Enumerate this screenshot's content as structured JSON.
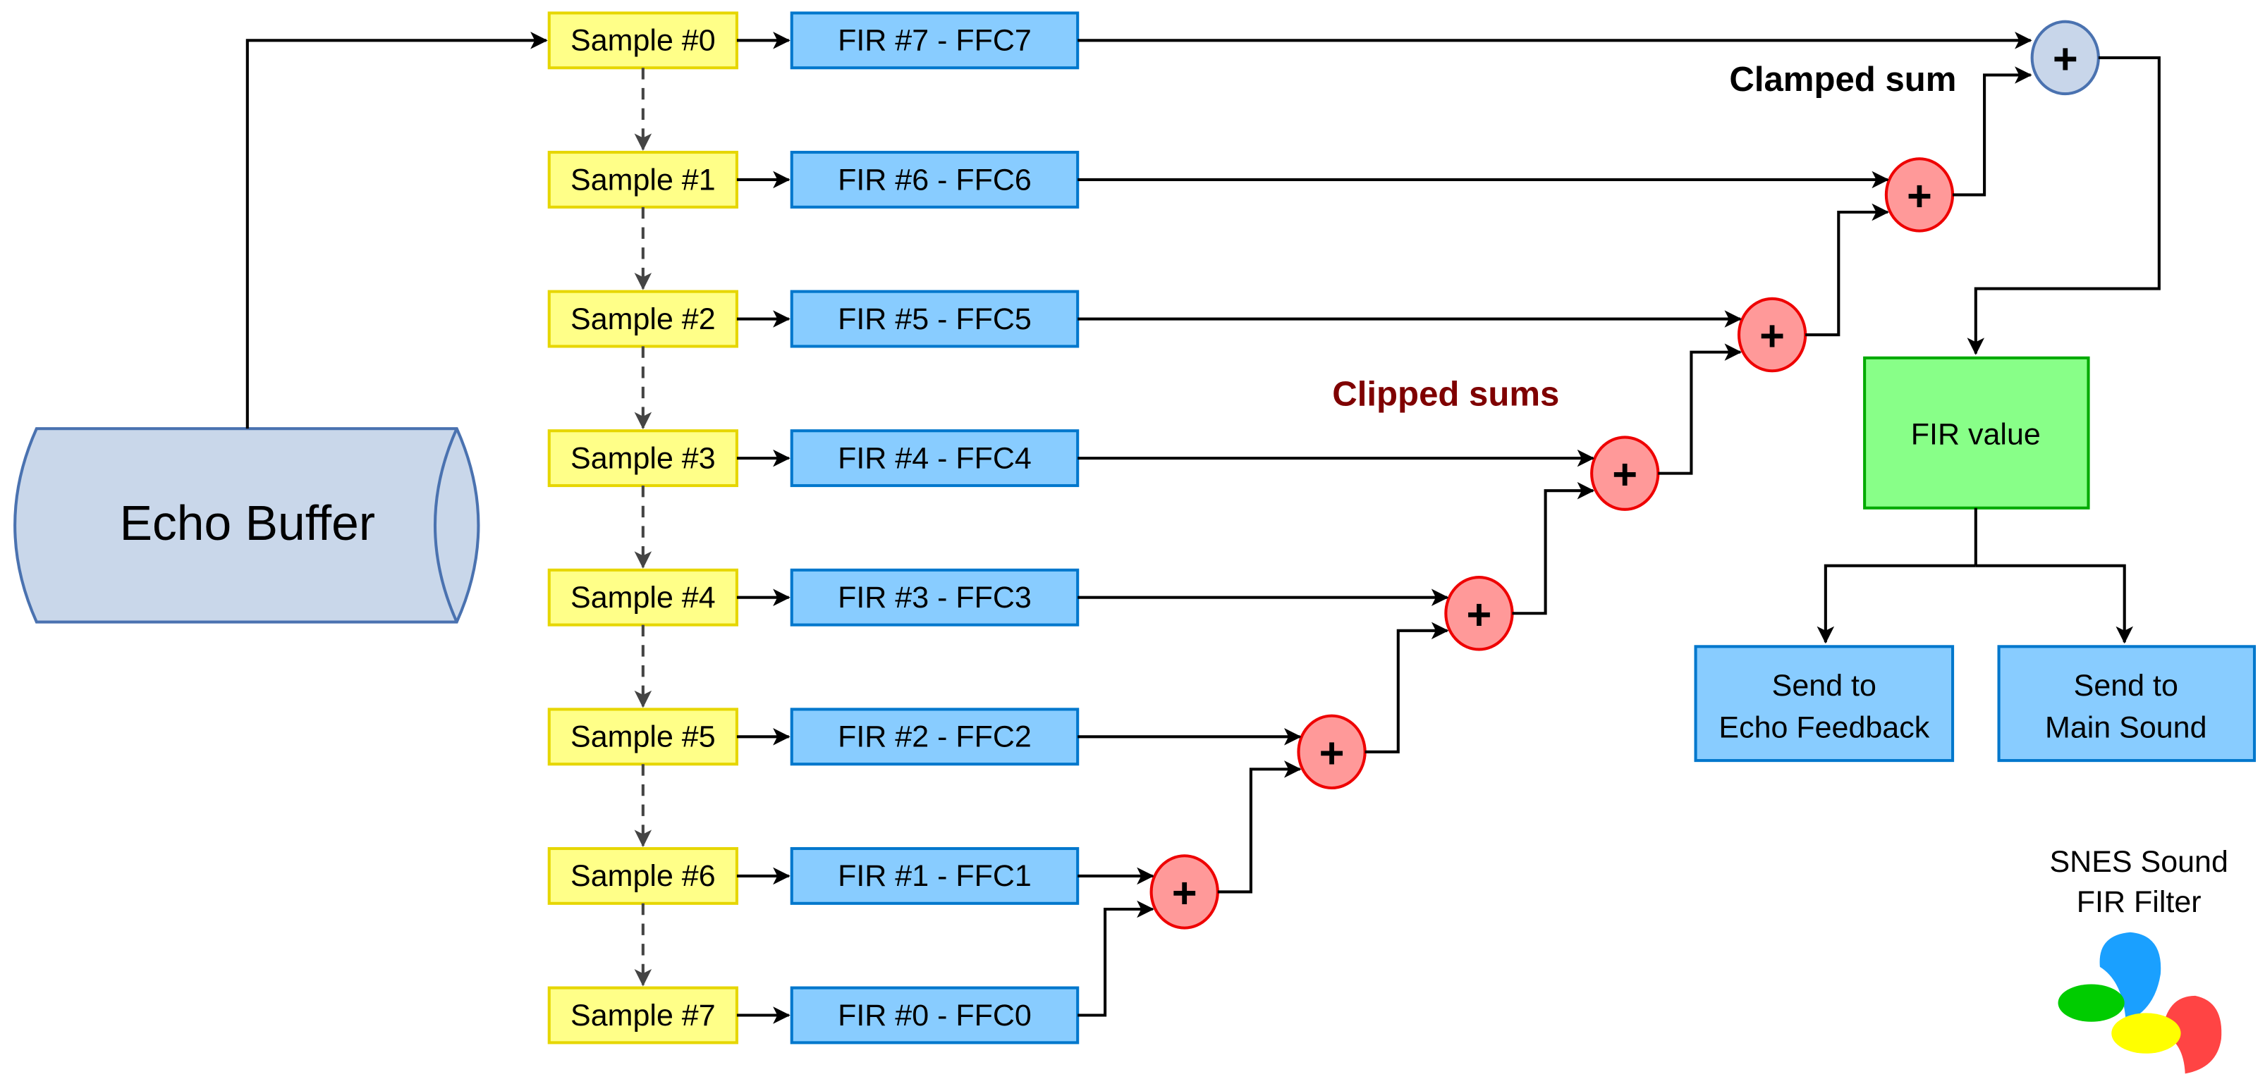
{
  "title": "SNES Sound FIR Filter",
  "title_lines": [
    "SNES Sound",
    "FIR Filter"
  ],
  "source": {
    "label": "Echo Buffer"
  },
  "samples": [
    "Sample #0",
    "Sample #1",
    "Sample #2",
    "Sample #3",
    "Sample #4",
    "Sample #5",
    "Sample #6",
    "Sample #7"
  ],
  "filters": [
    "FIR #7 - FFC7",
    "FIR #6 - FFC6",
    "FIR #5 - FFC5",
    "FIR #4 - FFC4",
    "FIR #3 - FFC3",
    "FIR #2 - FFC2",
    "FIR #1 - FFC1",
    "FIR #0 - FFC0"
  ],
  "adder_symbol": "+",
  "annotations": {
    "clipped_sums": "Clipped sums",
    "clamped_sum": "Clamped sum"
  },
  "output": {
    "label": "FIR value"
  },
  "destinations": [
    {
      "lines": [
        "Send to",
        "Echo Feedback"
      ]
    },
    {
      "lines": [
        "Send to",
        "Main Sound"
      ]
    }
  ],
  "colors": {
    "sample_fill": "#ffff88",
    "sample_stroke": "#e6d600",
    "fir_fill": "#88ccff",
    "fir_stroke": "#0077cc",
    "clipped_adder_fill": "#ff9999",
    "clipped_adder_stroke": "#ee0000",
    "clamped_adder_fill": "#c8d6ea",
    "clamped_adder_stroke": "#4a72b0",
    "echo_buffer_fill": "#c9d7ea",
    "echo_buffer_stroke": "#4a72b0",
    "output_fill": "#88ff88",
    "output_stroke": "#00aa00",
    "clipped_label": "#7f0000",
    "logo": [
      "#1aa0ff",
      "#ff4444",
      "#00cc00",
      "#ffff00"
    ]
  }
}
